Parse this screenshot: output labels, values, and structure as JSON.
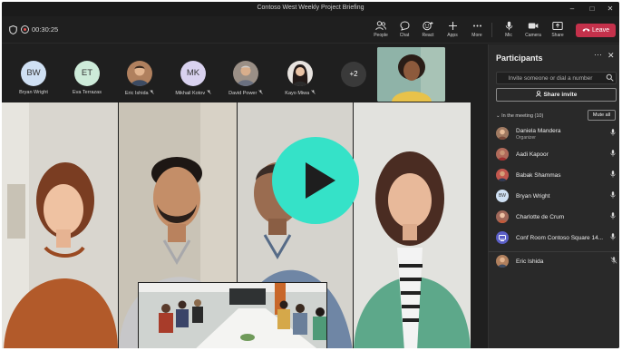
{
  "window": {
    "title": "Contoso West Weekly Project Briefing",
    "controls": [
      "–",
      "□",
      "✕"
    ]
  },
  "toolbar": {
    "timer": "00:30:25",
    "buttons": [
      {
        "label": "People",
        "icon": "people-icon"
      },
      {
        "label": "Chat",
        "icon": "chat-icon"
      },
      {
        "label": "React",
        "icon": "react-icon"
      },
      {
        "label": "Apps",
        "icon": "apps-icon"
      },
      {
        "label": "More",
        "icon": "more-icon"
      },
      {
        "label": "Mic",
        "icon": "mic-icon"
      },
      {
        "label": "Camera",
        "icon": "camera-icon"
      },
      {
        "label": "Share",
        "icon": "share-icon"
      }
    ],
    "leave_label": "Leave",
    "leave_color": "#c4314b"
  },
  "strip": {
    "attendees": [
      {
        "initials": "BW",
        "name": "Bryan Wright",
        "color": "#cfe0f3",
        "muted": false
      },
      {
        "initials": "ET",
        "name": "Eva Terrazas",
        "color": "#cdebd9",
        "muted": false
      },
      {
        "initials": "",
        "name": "Eric Ishida",
        "color": "#b0805e",
        "muted": true
      },
      {
        "initials": "MK",
        "name": "Mikhail Kotov",
        "color": "#d9d2ef",
        "muted": true
      },
      {
        "initials": "",
        "name": "David Power",
        "color": "#9a8f86",
        "muted": true
      },
      {
        "initials": "",
        "name": "Kayo Miwa",
        "color": "#5c4a44",
        "muted": true
      }
    ],
    "overflow_label": "+2"
  },
  "panel": {
    "title": "Participants",
    "invite_placeholder": "Invite someone or dial a number",
    "share_invite_label": "Share invite",
    "in_meeting_label": "In the meeting (10)",
    "mute_all_label": "Mute all",
    "participants": [
      {
        "name": "Daniela Mandera",
        "subtitle": "Organizer",
        "initials": "",
        "color": "#a07a62",
        "mic": "on"
      },
      {
        "name": "Aadi Kapoor",
        "subtitle": "",
        "initials": "",
        "color": "#b06a5a",
        "mic": "on"
      },
      {
        "name": "Babak Shammas",
        "subtitle": "",
        "initials": "",
        "color": "#c2574e",
        "mic": "on"
      },
      {
        "name": "Bryan Wright",
        "subtitle": "",
        "initials": "BW",
        "color": "#cfe0f3",
        "mic": "on"
      },
      {
        "name": "Charlotte de Crum",
        "subtitle": "",
        "initials": "",
        "color": "#a0685a",
        "mic": "on"
      },
      {
        "name": "Conf Room Contoso Square 14...",
        "subtitle": "",
        "initials": "",
        "color": "#5b5fc7",
        "mic": "on"
      },
      {
        "name": "Eric Ishida",
        "subtitle": "",
        "initials": "",
        "color": "#b0805e",
        "mic": "off"
      }
    ]
  },
  "video": {
    "play_color": "#35e2c8"
  }
}
